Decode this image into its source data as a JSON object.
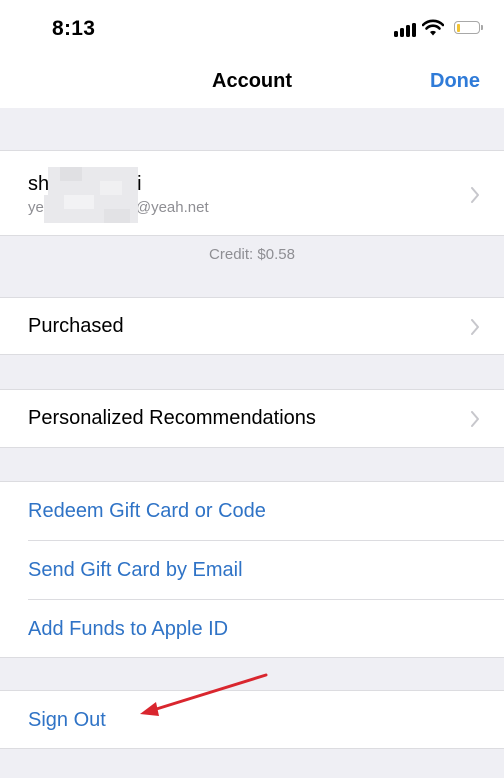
{
  "status_bar": {
    "time": "8:13"
  },
  "nav": {
    "title": "Account",
    "done_label": "Done"
  },
  "account": {
    "name": "sh i",
    "name_start": "sh",
    "name_end": "i",
    "email_start": "ye",
    "email_end": "@yeah.net",
    "credit": "Credit: $0.58"
  },
  "rows": {
    "purchased": "Purchased",
    "recommendations": "Personalized Recommendations",
    "redeem": "Redeem Gift Card or Code",
    "send_gift": "Send Gift Card by Email",
    "add_funds": "Add Funds to Apple ID",
    "sign_out": "Sign Out"
  },
  "colors": {
    "link": "#2f73c6",
    "done": "#2f7bd8",
    "background": "#efeff4",
    "annotation_arrow": "#d9262e"
  },
  "icons": [
    "signal-icon",
    "wifi-icon",
    "battery-icon",
    "chevron-right-icon",
    "red-arrow-annotation"
  ]
}
